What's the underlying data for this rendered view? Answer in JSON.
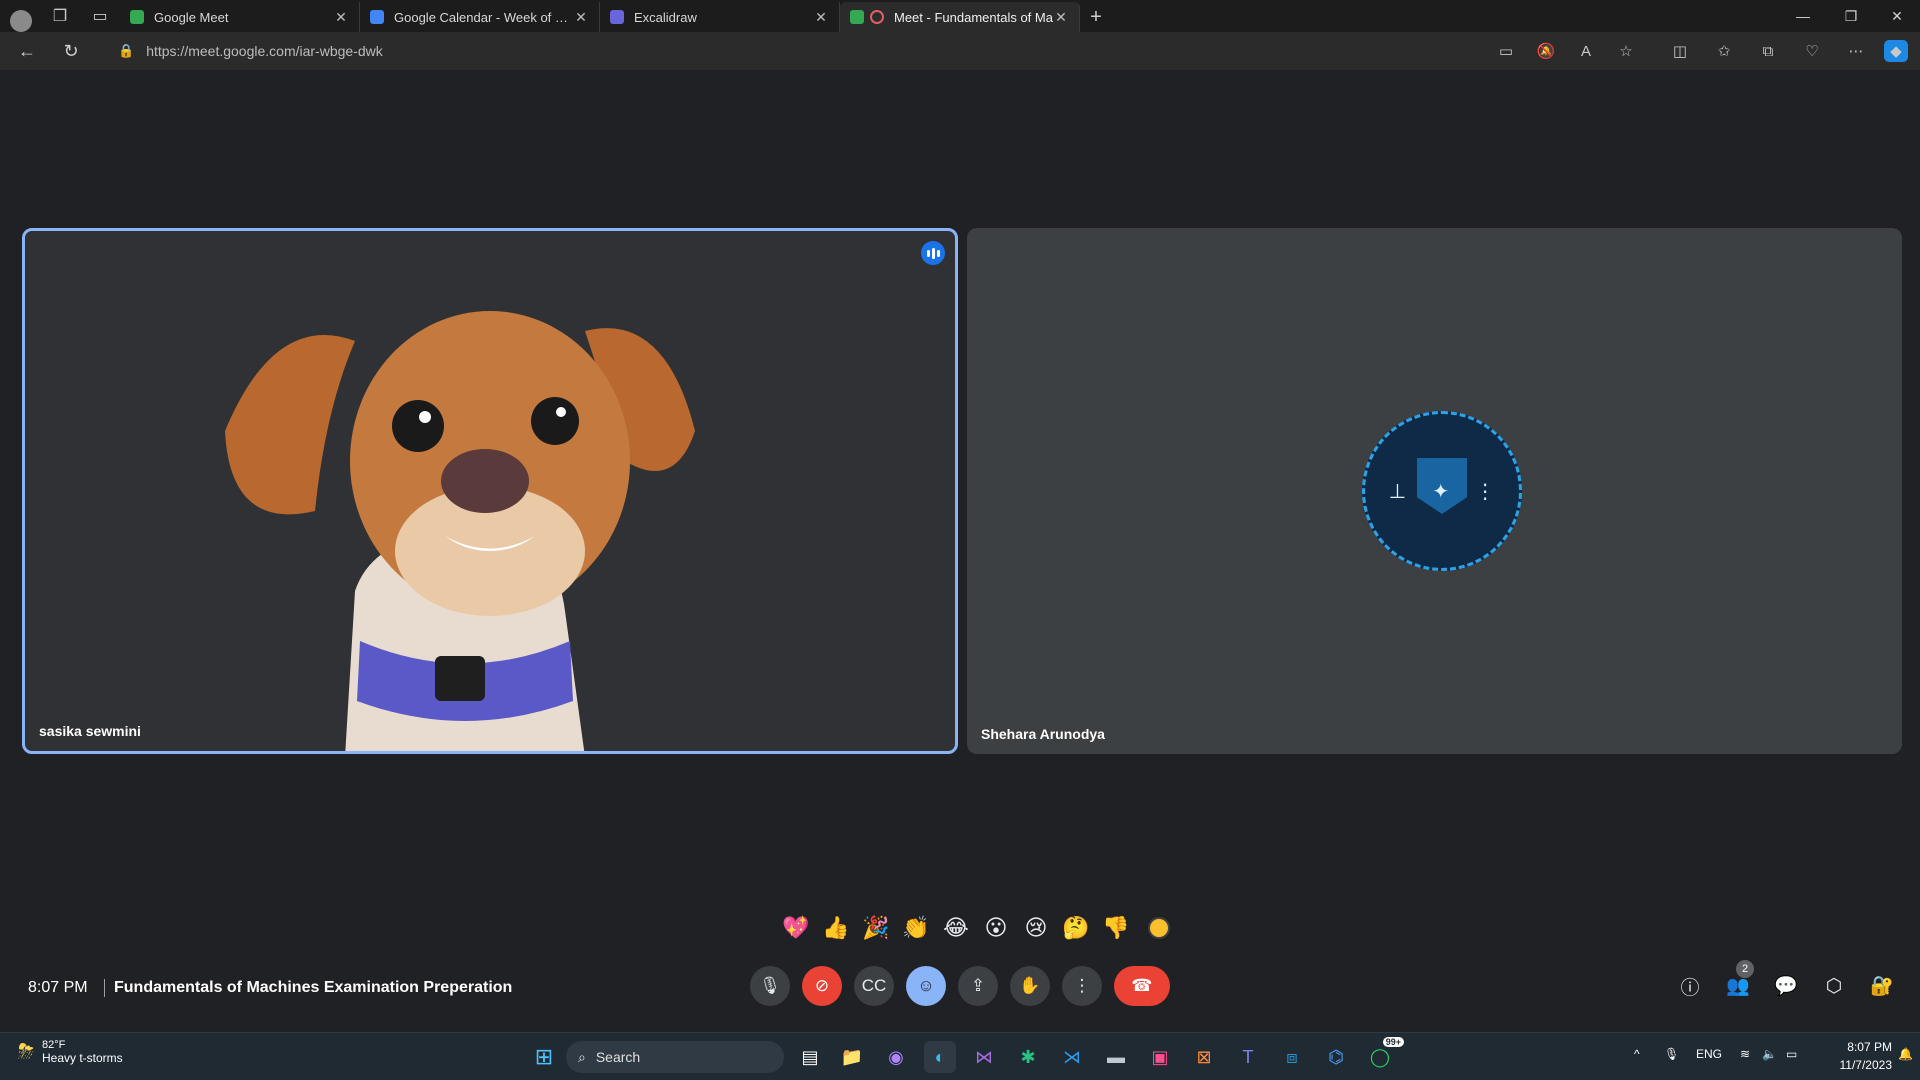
{
  "tabs": [
    {
      "title": "Google Meet",
      "favicon_color": "#34a853"
    },
    {
      "title": "Google Calendar - Week of Nove",
      "favicon_color": "#4285f4"
    },
    {
      "title": "Excalidraw",
      "favicon_color": "#6965db"
    },
    {
      "title": "Meet - Fundamentals of Ma",
      "favicon_color": "#34a853",
      "active": true
    }
  ],
  "address": {
    "url": "https://meet.google.com/iar-wbge-dwk"
  },
  "participants": [
    {
      "name": "sasika sewmini",
      "speaking": true
    },
    {
      "name": "Shehara Arunodya"
    }
  ],
  "reactions": [
    "💖",
    "👍",
    "🎉",
    "👏",
    "😂",
    "😮",
    "😢",
    "🤔",
    "👎"
  ],
  "meeting": {
    "time": "8:07 PM",
    "title": "Fundamentals of Machines Examination Preperation",
    "participant_count": "2"
  },
  "taskbar": {
    "weather_temp": "82°F",
    "weather_desc": "Heavy t-storms",
    "search_label": "Search",
    "lang": "ENG",
    "time": "8:07 PM",
    "date": "11/7/2023",
    "whatsapp_badge": "99+"
  },
  "colors": {
    "accent": "#8ab4f8",
    "danger": "#ea4335",
    "meet_bg": "#202124"
  }
}
